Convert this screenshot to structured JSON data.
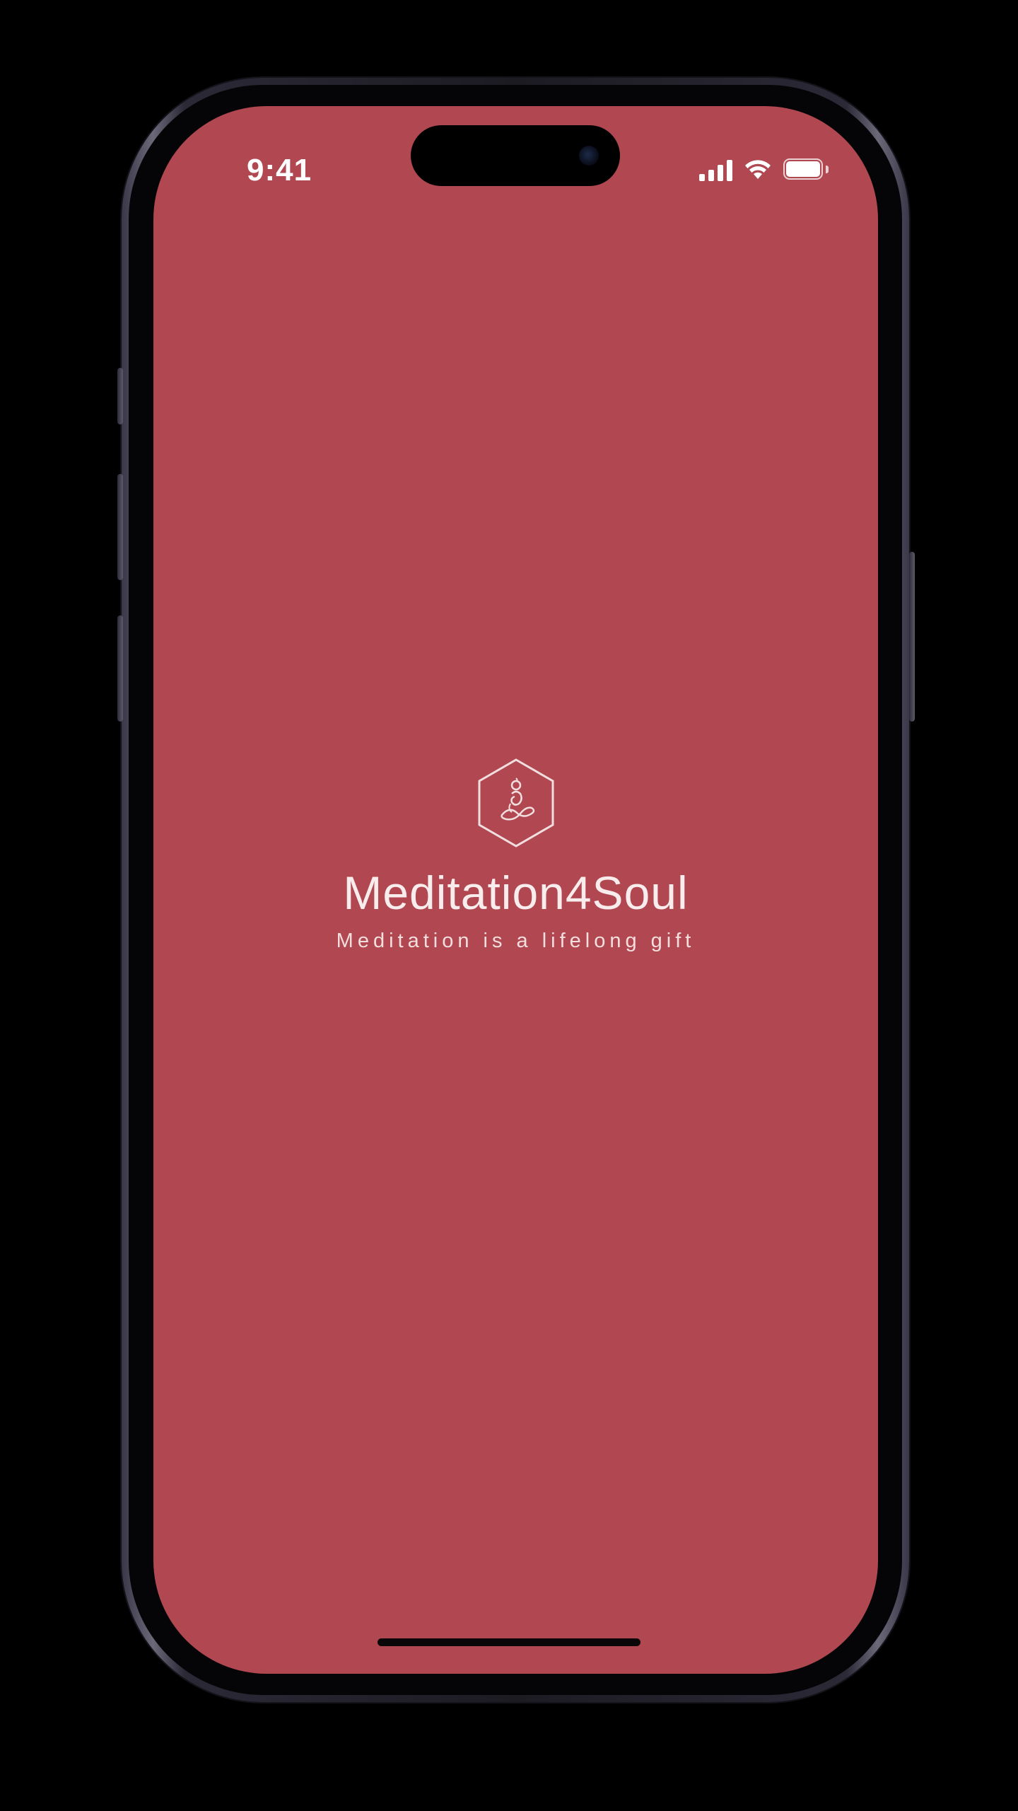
{
  "status_bar": {
    "time": "9:41",
    "icons": [
      "cellular-signal-icon",
      "wifi-icon",
      "battery-icon"
    ],
    "text_color": "#ffffff"
  },
  "splash": {
    "logo_icon": "meditation-figure-hexagon-icon",
    "app_name": "Meditation4Soul",
    "tagline": "Meditation is a lifelong gift",
    "background_color": "#b04751",
    "foreground_color": "#f8ecec"
  },
  "device": {
    "frame_color": "#2b2936",
    "home_indicator_color": "#0b0708"
  }
}
